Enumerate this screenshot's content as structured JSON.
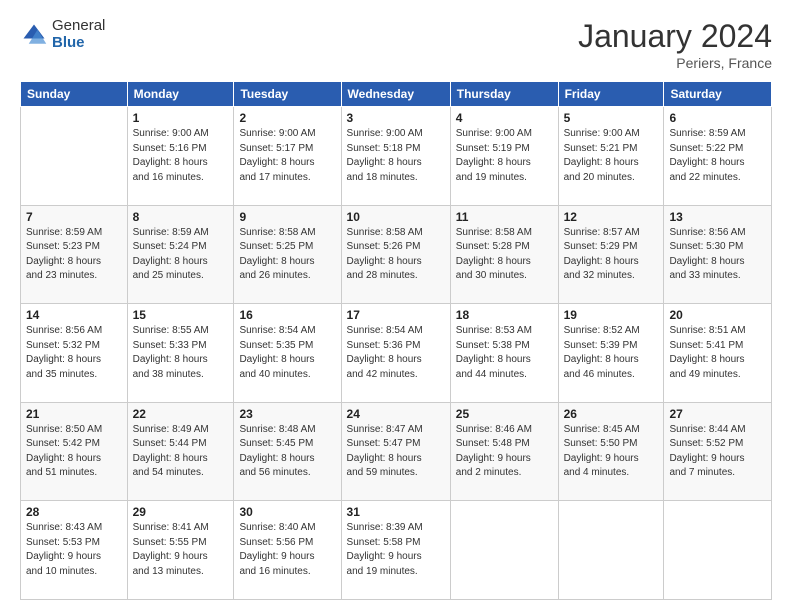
{
  "logo": {
    "general": "General",
    "blue": "Blue"
  },
  "title": "January 2024",
  "location": "Periers, France",
  "days_header": [
    "Sunday",
    "Monday",
    "Tuesday",
    "Wednesday",
    "Thursday",
    "Friday",
    "Saturday"
  ],
  "weeks": [
    [
      {
        "day": "",
        "sunrise": "",
        "sunset": "",
        "daylight": ""
      },
      {
        "day": "1",
        "sunrise": "Sunrise: 9:00 AM",
        "sunset": "Sunset: 5:16 PM",
        "daylight": "Daylight: 8 hours and 16 minutes."
      },
      {
        "day": "2",
        "sunrise": "Sunrise: 9:00 AM",
        "sunset": "Sunset: 5:17 PM",
        "daylight": "Daylight: 8 hours and 17 minutes."
      },
      {
        "day": "3",
        "sunrise": "Sunrise: 9:00 AM",
        "sunset": "Sunset: 5:18 PM",
        "daylight": "Daylight: 8 hours and 18 minutes."
      },
      {
        "day": "4",
        "sunrise": "Sunrise: 9:00 AM",
        "sunset": "Sunset: 5:19 PM",
        "daylight": "Daylight: 8 hours and 19 minutes."
      },
      {
        "day": "5",
        "sunrise": "Sunrise: 9:00 AM",
        "sunset": "Sunset: 5:21 PM",
        "daylight": "Daylight: 8 hours and 20 minutes."
      },
      {
        "day": "6",
        "sunrise": "Sunrise: 8:59 AM",
        "sunset": "Sunset: 5:22 PM",
        "daylight": "Daylight: 8 hours and 22 minutes."
      }
    ],
    [
      {
        "day": "7",
        "sunrise": "Sunrise: 8:59 AM",
        "sunset": "Sunset: 5:23 PM",
        "daylight": "Daylight: 8 hours and 23 minutes."
      },
      {
        "day": "8",
        "sunrise": "Sunrise: 8:59 AM",
        "sunset": "Sunset: 5:24 PM",
        "daylight": "Daylight: 8 hours and 25 minutes."
      },
      {
        "day": "9",
        "sunrise": "Sunrise: 8:58 AM",
        "sunset": "Sunset: 5:25 PM",
        "daylight": "Daylight: 8 hours and 26 minutes."
      },
      {
        "day": "10",
        "sunrise": "Sunrise: 8:58 AM",
        "sunset": "Sunset: 5:26 PM",
        "daylight": "Daylight: 8 hours and 28 minutes."
      },
      {
        "day": "11",
        "sunrise": "Sunrise: 8:58 AM",
        "sunset": "Sunset: 5:28 PM",
        "daylight": "Daylight: 8 hours and 30 minutes."
      },
      {
        "day": "12",
        "sunrise": "Sunrise: 8:57 AM",
        "sunset": "Sunset: 5:29 PM",
        "daylight": "Daylight: 8 hours and 32 minutes."
      },
      {
        "day": "13",
        "sunrise": "Sunrise: 8:56 AM",
        "sunset": "Sunset: 5:30 PM",
        "daylight": "Daylight: 8 hours and 33 minutes."
      }
    ],
    [
      {
        "day": "14",
        "sunrise": "Sunrise: 8:56 AM",
        "sunset": "Sunset: 5:32 PM",
        "daylight": "Daylight: 8 hours and 35 minutes."
      },
      {
        "day": "15",
        "sunrise": "Sunrise: 8:55 AM",
        "sunset": "Sunset: 5:33 PM",
        "daylight": "Daylight: 8 hours and 38 minutes."
      },
      {
        "day": "16",
        "sunrise": "Sunrise: 8:54 AM",
        "sunset": "Sunset: 5:35 PM",
        "daylight": "Daylight: 8 hours and 40 minutes."
      },
      {
        "day": "17",
        "sunrise": "Sunrise: 8:54 AM",
        "sunset": "Sunset: 5:36 PM",
        "daylight": "Daylight: 8 hours and 42 minutes."
      },
      {
        "day": "18",
        "sunrise": "Sunrise: 8:53 AM",
        "sunset": "Sunset: 5:38 PM",
        "daylight": "Daylight: 8 hours and 44 minutes."
      },
      {
        "day": "19",
        "sunrise": "Sunrise: 8:52 AM",
        "sunset": "Sunset: 5:39 PM",
        "daylight": "Daylight: 8 hours and 46 minutes."
      },
      {
        "day": "20",
        "sunrise": "Sunrise: 8:51 AM",
        "sunset": "Sunset: 5:41 PM",
        "daylight": "Daylight: 8 hours and 49 minutes."
      }
    ],
    [
      {
        "day": "21",
        "sunrise": "Sunrise: 8:50 AM",
        "sunset": "Sunset: 5:42 PM",
        "daylight": "Daylight: 8 hours and 51 minutes."
      },
      {
        "day": "22",
        "sunrise": "Sunrise: 8:49 AM",
        "sunset": "Sunset: 5:44 PM",
        "daylight": "Daylight: 8 hours and 54 minutes."
      },
      {
        "day": "23",
        "sunrise": "Sunrise: 8:48 AM",
        "sunset": "Sunset: 5:45 PM",
        "daylight": "Daylight: 8 hours and 56 minutes."
      },
      {
        "day": "24",
        "sunrise": "Sunrise: 8:47 AM",
        "sunset": "Sunset: 5:47 PM",
        "daylight": "Daylight: 8 hours and 59 minutes."
      },
      {
        "day": "25",
        "sunrise": "Sunrise: 8:46 AM",
        "sunset": "Sunset: 5:48 PM",
        "daylight": "Daylight: 9 hours and 2 minutes."
      },
      {
        "day": "26",
        "sunrise": "Sunrise: 8:45 AM",
        "sunset": "Sunset: 5:50 PM",
        "daylight": "Daylight: 9 hours and 4 minutes."
      },
      {
        "day": "27",
        "sunrise": "Sunrise: 8:44 AM",
        "sunset": "Sunset: 5:52 PM",
        "daylight": "Daylight: 9 hours and 7 minutes."
      }
    ],
    [
      {
        "day": "28",
        "sunrise": "Sunrise: 8:43 AM",
        "sunset": "Sunset: 5:53 PM",
        "daylight": "Daylight: 9 hours and 10 minutes."
      },
      {
        "day": "29",
        "sunrise": "Sunrise: 8:41 AM",
        "sunset": "Sunset: 5:55 PM",
        "daylight": "Daylight: 9 hours and 13 minutes."
      },
      {
        "day": "30",
        "sunrise": "Sunrise: 8:40 AM",
        "sunset": "Sunset: 5:56 PM",
        "daylight": "Daylight: 9 hours and 16 minutes."
      },
      {
        "day": "31",
        "sunrise": "Sunrise: 8:39 AM",
        "sunset": "Sunset: 5:58 PM",
        "daylight": "Daylight: 9 hours and 19 minutes."
      },
      {
        "day": "",
        "sunrise": "",
        "sunset": "",
        "daylight": ""
      },
      {
        "day": "",
        "sunrise": "",
        "sunset": "",
        "daylight": ""
      },
      {
        "day": "",
        "sunrise": "",
        "sunset": "",
        "daylight": ""
      }
    ]
  ]
}
